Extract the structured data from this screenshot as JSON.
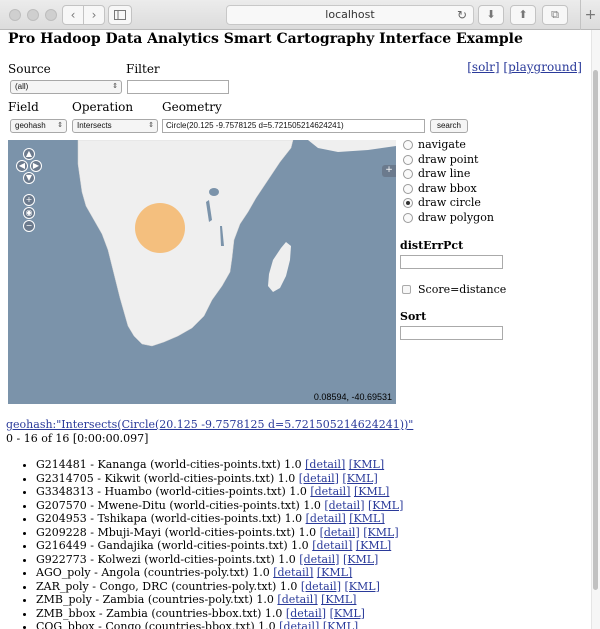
{
  "browser": {
    "url": "localhost",
    "back_glyph": "‹",
    "forward_glyph": "›",
    "reload_glyph": "↻",
    "download_glyph": "⬇",
    "share_glyph": "⬆",
    "tabs_glyph": "⧉",
    "new_tab_glyph": "+"
  },
  "header": {
    "title": "Pro Hadoop Data Analytics Smart Cartography Interface Example",
    "links": [
      {
        "label": "[solr]"
      },
      {
        "label": "[playground]"
      }
    ]
  },
  "form": {
    "source_label": "Source",
    "filter_label": "Filter",
    "source_value": "(all)",
    "filter_value": "",
    "field_label": "Field",
    "operation_label": "Operation",
    "geometry_label": "Geometry",
    "field_value": "geohash",
    "operation_value": "Intersects",
    "geometry_value": "Circle(20.125 -9.7578125 d=5.721505214624241)",
    "search_label": "search"
  },
  "map": {
    "mouse_position": "0.08594, -40.69531",
    "zoom_in": "+",
    "zoom_out": "−",
    "layer_switcher": "+",
    "water_color": "#7b93aa",
    "land_color": "#efefef",
    "circle_color": "#f4b66a"
  },
  "panel": {
    "tools": [
      {
        "label": "navigate",
        "selected": false
      },
      {
        "label": "draw point",
        "selected": false
      },
      {
        "label": "draw line",
        "selected": false
      },
      {
        "label": "draw bbox",
        "selected": false
      },
      {
        "label": "draw circle",
        "selected": true
      },
      {
        "label": "draw polygon",
        "selected": false
      }
    ],
    "dist_err_label": "distErrPct",
    "dist_err_value": "",
    "score_label": "Score=distance",
    "sort_label": "Sort",
    "sort_value": ""
  },
  "results": {
    "query_link": "geohash:\"Intersects(Circle(20.125 -9.7578125 d=5.721505214624241))\"",
    "summary": "0 - 16 of 16 [0:00:00.097]",
    "detail_label": "[detail]",
    "kml_label": "[KML]",
    "items": [
      {
        "text": "G214481 - Kananga (world-cities-points.txt) 1.0"
      },
      {
        "text": "G2314705 - Kikwit (world-cities-points.txt) 1.0"
      },
      {
        "text": "G3348313 - Huambo (world-cities-points.txt) 1.0"
      },
      {
        "text": "G207570 - Mwene-Ditu (world-cities-points.txt) 1.0"
      },
      {
        "text": "G204953 - Tshikapa (world-cities-points.txt) 1.0"
      },
      {
        "text": "G209228 - Mbuji-Mayi (world-cities-points.txt) 1.0"
      },
      {
        "text": "G216449 - Gandajika (world-cities-points.txt) 1.0"
      },
      {
        "text": "G922773 - Kolwezi (world-cities-points.txt) 1.0"
      },
      {
        "text": "AGO_poly - Angola (countries-poly.txt) 1.0"
      },
      {
        "text": "ZAR_poly - Congo, DRC (countries-poly.txt) 1.0"
      },
      {
        "text": "ZMB_poly - Zambia (countries-poly.txt) 1.0"
      },
      {
        "text": "ZMB_bbox - Zambia (countries-bbox.txt) 1.0"
      },
      {
        "text": "COG_bbox - Congo (countries-bbox.txt) 1.0"
      }
    ]
  }
}
